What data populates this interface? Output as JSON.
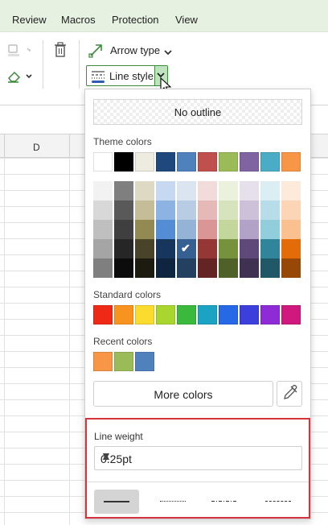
{
  "ribbon": {
    "tabs": [
      "Review",
      "Macros",
      "Protection",
      "View"
    ]
  },
  "toolbar": {
    "arrow_type_label": "Arrow type",
    "line_style_label": "Line style"
  },
  "sheet": {
    "column_header": "D"
  },
  "panel": {
    "no_outline_label": "No outline",
    "theme_colors_title": "Theme colors",
    "theme_colors": [
      "#ffffff",
      "#000000",
      "#eeece1",
      "#1f497d",
      "#4f81bd",
      "#c0504d",
      "#9bbb59",
      "#8064a2",
      "#4bacc6",
      "#f79646"
    ],
    "shade_rows": [
      [
        "#f2f2f2",
        "#7f7f7f",
        "#ddd9c3",
        "#c6d9f0",
        "#dbe5f1",
        "#f2dcdb",
        "#ebf1dd",
        "#e5e0ec",
        "#dbeef3",
        "#fdeada"
      ],
      [
        "#d8d8d8",
        "#595959",
        "#c4bd97",
        "#8db3e2",
        "#b8cce4",
        "#e5b9b7",
        "#d7e3bc",
        "#ccc1d9",
        "#b7dde8",
        "#fbd5b5"
      ],
      [
        "#bfbfbf",
        "#3f3f3f",
        "#938953",
        "#548dd4",
        "#95b3d7",
        "#d99694",
        "#c3d69b",
        "#b2a2c7",
        "#92cddc",
        "#fac08f"
      ],
      [
        "#a5a5a5",
        "#262626",
        "#494429",
        "#17365d",
        "#366092",
        "#953734",
        "#76923c",
        "#5f497a",
        "#31859b",
        "#e36c09"
      ],
      [
        "#7f7f7f",
        "#0c0c0c",
        "#1d1b10",
        "#0f243e",
        "#244061",
        "#632423",
        "#4f6128",
        "#3f3151",
        "#205867",
        "#974806"
      ]
    ],
    "selected_shade": {
      "row": 3,
      "col": 4
    },
    "standard_colors_title": "Standard colors",
    "standard_colors": [
      "#ee2a17",
      "#f7931e",
      "#fbdb2e",
      "#a8d62e",
      "#3bb93d",
      "#1ca3c4",
      "#2668e6",
      "#3c3fdc",
      "#8e2bd6",
      "#d0187e"
    ],
    "recent_colors_title": "Recent colors",
    "recent_colors": [
      "#f79646",
      "#9bbb59",
      "#4f81bd"
    ],
    "more_colors_label": "More colors",
    "line_weight_title": "Line weight",
    "line_weight_value": "0.25pt",
    "line_styles": [
      "solid",
      "dotted",
      "dash-dot",
      "dashed"
    ],
    "selected_line_style": "solid",
    "highlight_color": "#d6333f"
  }
}
